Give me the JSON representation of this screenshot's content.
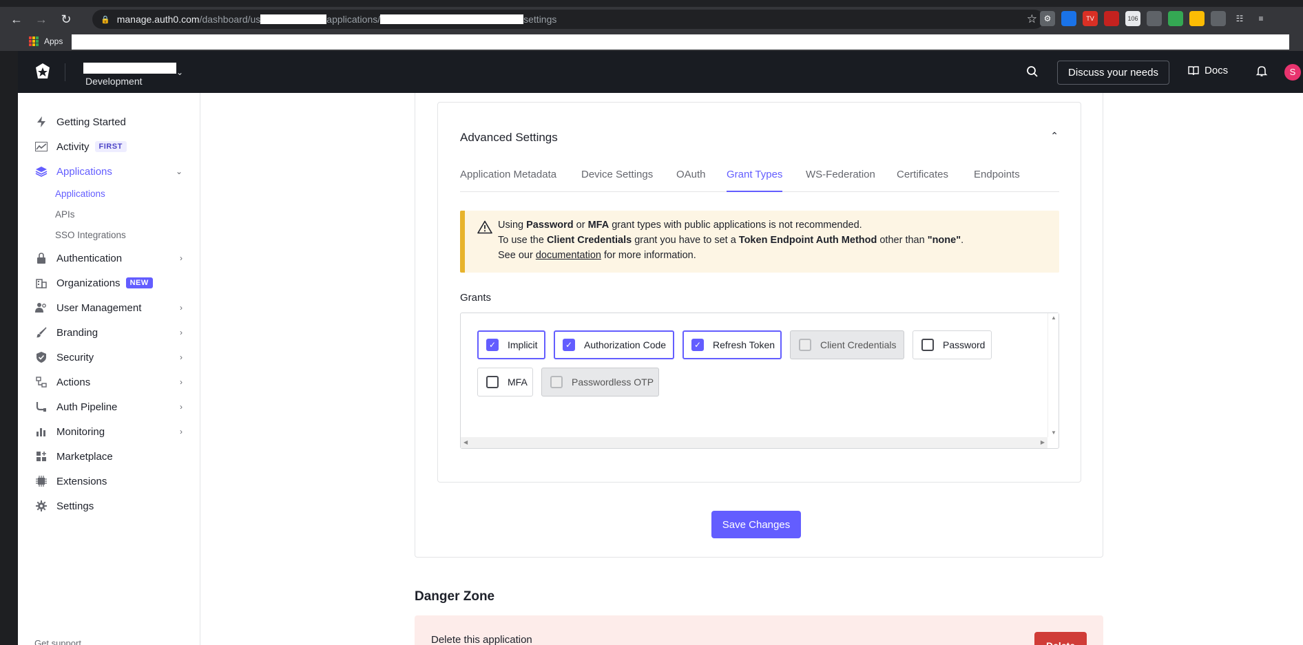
{
  "browser": {
    "url_host": "manage.auth0.com",
    "url_path_1": "/dashboard/us",
    "url_path_2": "applications/",
    "url_path_3": "settings",
    "bookmarks_apps_label": "Apps"
  },
  "header": {
    "environment": "Development",
    "discuss_label": "Discuss your needs",
    "docs_label": "Docs",
    "avatar_initial": "S"
  },
  "sidebar": {
    "items": [
      {
        "label": "Getting Started"
      },
      {
        "label": "Activity",
        "badge": "FIRST"
      },
      {
        "label": "Applications"
      },
      {
        "label": "Authentication"
      },
      {
        "label": "Organizations",
        "badge": "NEW"
      },
      {
        "label": "User Management"
      },
      {
        "label": "Branding"
      },
      {
        "label": "Security"
      },
      {
        "label": "Actions"
      },
      {
        "label": "Auth Pipeline"
      },
      {
        "label": "Monitoring"
      },
      {
        "label": "Marketplace"
      },
      {
        "label": "Extensions"
      },
      {
        "label": "Settings"
      }
    ],
    "sub_items": [
      {
        "label": "Applications"
      },
      {
        "label": "APIs"
      },
      {
        "label": "SSO Integrations"
      }
    ],
    "get_support": "Get support"
  },
  "advanced": {
    "title": "Advanced Settings",
    "tabs": [
      {
        "label": "Application Metadata"
      },
      {
        "label": "Device Settings"
      },
      {
        "label": "OAuth"
      },
      {
        "label": "Grant Types"
      },
      {
        "label": "WS-Federation"
      },
      {
        "label": "Certificates"
      },
      {
        "label": "Endpoints"
      }
    ],
    "active_tab": "Grant Types",
    "warning": {
      "l1_a": "Using ",
      "l1_b": "Password",
      "l1_c": " or ",
      "l1_d": "MFA",
      "l1_e": " grant types with public applications is not recommended.",
      "l2_a": "To use the ",
      "l2_b": "Client Credentials",
      "l2_c": " grant you have to set a ",
      "l2_d": "Token Endpoint Auth Method",
      "l2_e": " other than ",
      "l2_f": "\"none\"",
      "l2_g": ".",
      "l3_a": "See our ",
      "l3_b": "documentation",
      "l3_c": " for more information."
    },
    "grants_label": "Grants",
    "grants": [
      {
        "label": "Implicit",
        "checked": true,
        "disabled": false
      },
      {
        "label": "Authorization Code",
        "checked": true,
        "disabled": false
      },
      {
        "label": "Refresh Token",
        "checked": true,
        "disabled": false
      },
      {
        "label": "Client Credentials",
        "checked": false,
        "disabled": true
      },
      {
        "label": "Password",
        "checked": false,
        "disabled": false
      },
      {
        "label": "MFA",
        "checked": false,
        "disabled": false
      },
      {
        "label": "Passwordless OTP",
        "checked": false,
        "disabled": true
      }
    ]
  },
  "save_label": "Save Changes",
  "danger": {
    "title": "Danger Zone",
    "delete_text": "Delete this application",
    "delete_button": "Delete"
  },
  "colors": {
    "accent": "#635dff",
    "warning_bar": "#e7b32c",
    "danger": "#d03c38"
  }
}
